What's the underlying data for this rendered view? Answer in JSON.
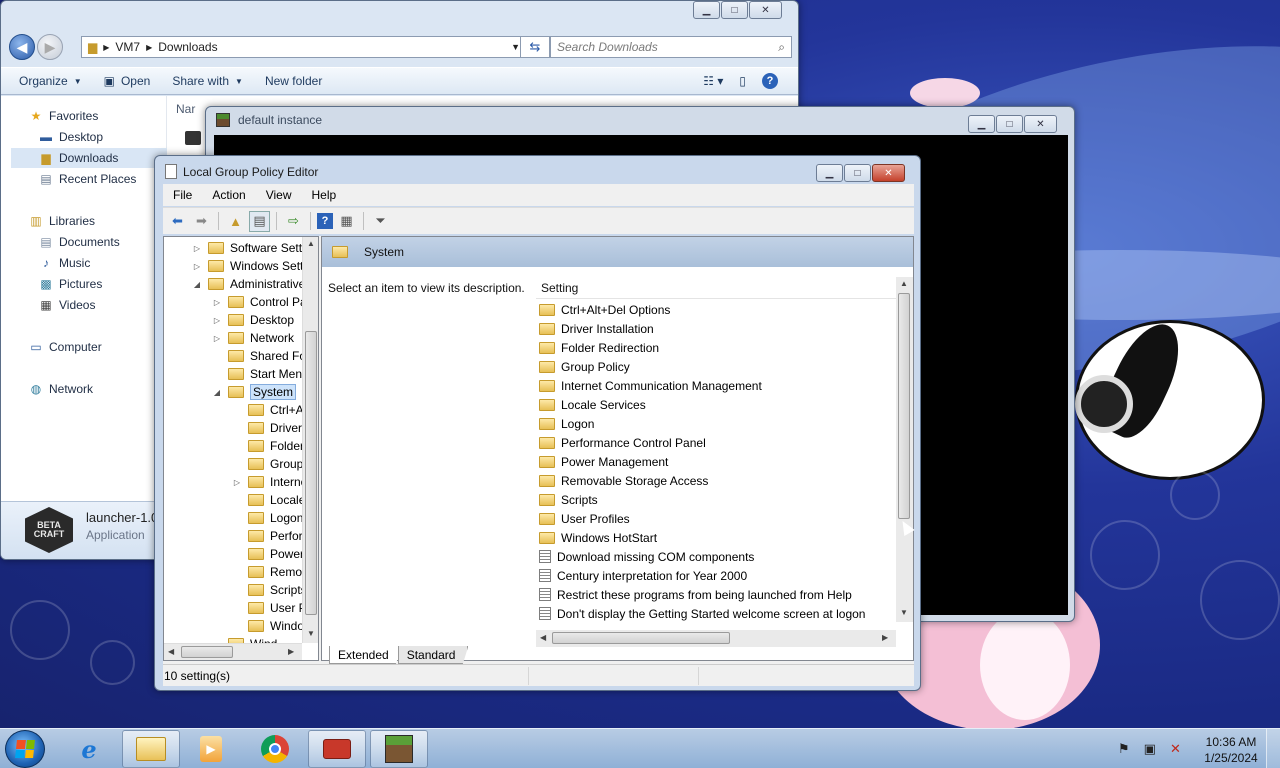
{
  "explorer": {
    "breadcrumb": [
      "VM7",
      "Downloads"
    ],
    "search_placeholder": "Search Downloads",
    "toolbar": {
      "organize": "Organize",
      "open": "Open",
      "share_with": "Share with",
      "new_folder": "New folder"
    },
    "nav": {
      "favorites": "Favorites",
      "desktop": "Desktop",
      "downloads": "Downloads",
      "recent_places": "Recent Places",
      "libraries": "Libraries",
      "documents": "Documents",
      "music": "Music",
      "pictures": "Pictures",
      "videos": "Videos",
      "computer": "Computer",
      "network": "Network"
    },
    "column_name": "Nar",
    "details": {
      "name": "launcher-1.0",
      "type": "Application",
      "icon_text": "BETA CRAFT"
    }
  },
  "minecraft": {
    "title": "default instance"
  },
  "gpe": {
    "title": "Local Group Policy Editor",
    "menu": [
      "File",
      "Action",
      "View",
      "Help"
    ],
    "tree": [
      {
        "label": "Software Setti",
        "indent": 1,
        "expander": "▷"
      },
      {
        "label": "Windows Sett",
        "indent": 1,
        "expander": "▷"
      },
      {
        "label": "Administrative",
        "indent": 1,
        "expander": "◢"
      },
      {
        "label": "Control Pa",
        "indent": 2,
        "expander": "▷"
      },
      {
        "label": "Desktop",
        "indent": 2,
        "expander": "▷"
      },
      {
        "label": "Network",
        "indent": 2,
        "expander": "▷"
      },
      {
        "label": "Shared Fol",
        "indent": 2,
        "expander": ""
      },
      {
        "label": "Start Menu",
        "indent": 2,
        "expander": ""
      },
      {
        "label": "System",
        "indent": 2,
        "expander": "◢",
        "selected": true
      },
      {
        "label": "Ctrl+A",
        "indent": 3,
        "expander": ""
      },
      {
        "label": "Driver I",
        "indent": 3,
        "expander": ""
      },
      {
        "label": "Folder",
        "indent": 3,
        "expander": ""
      },
      {
        "label": "Group",
        "indent": 3,
        "expander": ""
      },
      {
        "label": "Interne",
        "indent": 3,
        "expander": "▷"
      },
      {
        "label": "Locale",
        "indent": 3,
        "expander": ""
      },
      {
        "label": "Logon",
        "indent": 3,
        "expander": ""
      },
      {
        "label": "Perforr",
        "indent": 3,
        "expander": ""
      },
      {
        "label": "Power",
        "indent": 3,
        "expander": ""
      },
      {
        "label": "Remov",
        "indent": 3,
        "expander": ""
      },
      {
        "label": "Scripts",
        "indent": 3,
        "expander": ""
      },
      {
        "label": "User Pr",
        "indent": 3,
        "expander": ""
      },
      {
        "label": "Windo",
        "indent": 3,
        "expander": ""
      },
      {
        "label": "Wind",
        "indent": 2,
        "expander": ""
      }
    ],
    "header": "System",
    "description": "Select an item to view its description.",
    "column_setting": "Setting",
    "settings": [
      {
        "label": "Ctrl+Alt+Del Options",
        "kind": "folder"
      },
      {
        "label": "Driver Installation",
        "kind": "folder"
      },
      {
        "label": "Folder Redirection",
        "kind": "folder"
      },
      {
        "label": "Group Policy",
        "kind": "folder"
      },
      {
        "label": "Internet Communication Management",
        "kind": "folder"
      },
      {
        "label": "Locale Services",
        "kind": "folder"
      },
      {
        "label": "Logon",
        "kind": "folder"
      },
      {
        "label": "Performance Control Panel",
        "kind": "folder"
      },
      {
        "label": "Power Management",
        "kind": "folder"
      },
      {
        "label": "Removable Storage Access",
        "kind": "folder"
      },
      {
        "label": "Scripts",
        "kind": "folder"
      },
      {
        "label": "User Profiles",
        "kind": "folder"
      },
      {
        "label": "Windows HotStart",
        "kind": "folder"
      },
      {
        "label": "Download missing COM components",
        "kind": "policy"
      },
      {
        "label": "Century interpretation for Year 2000",
        "kind": "policy"
      },
      {
        "label": "Restrict these programs from being launched from Help",
        "kind": "policy"
      },
      {
        "label": "Don't display the Getting Started welcome screen at logon",
        "kind": "policy"
      }
    ],
    "tabs": [
      "Extended",
      "Standard"
    ],
    "status": "10 setting(s)"
  },
  "taskbar": {
    "apps": [
      "internet-explorer",
      "windows-explorer",
      "media-player",
      "chrome",
      "toolbox",
      "minecraft"
    ],
    "time": "10:36 AM",
    "date": "1/25/2024"
  }
}
